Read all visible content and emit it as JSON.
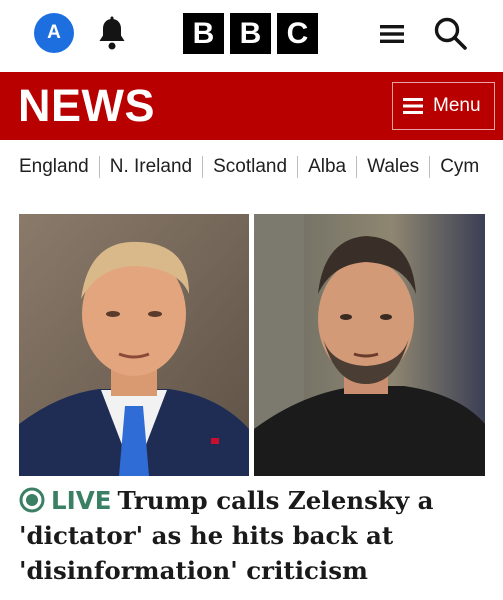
{
  "account": {
    "initial": "A"
  },
  "logo": {
    "letters": [
      "B",
      "B",
      "C"
    ]
  },
  "newsbar": {
    "title": "NEWS",
    "menu_label": "Menu"
  },
  "regions": [
    "England",
    "N. Ireland",
    "Scotland",
    "Alba",
    "Wales",
    "Cym"
  ],
  "story": {
    "live_label": "LIVE",
    "headline": "Trump calls Zelensky a 'dictator' as he hits back at 'disinformation' criticism"
  },
  "colors": {
    "brand_red": "#b80000",
    "live_green": "#3b7f65",
    "avatar_blue": "#1d6fe0"
  },
  "icons": [
    "account-icon",
    "bell-icon",
    "menu-icon",
    "search-icon",
    "live-icon"
  ]
}
